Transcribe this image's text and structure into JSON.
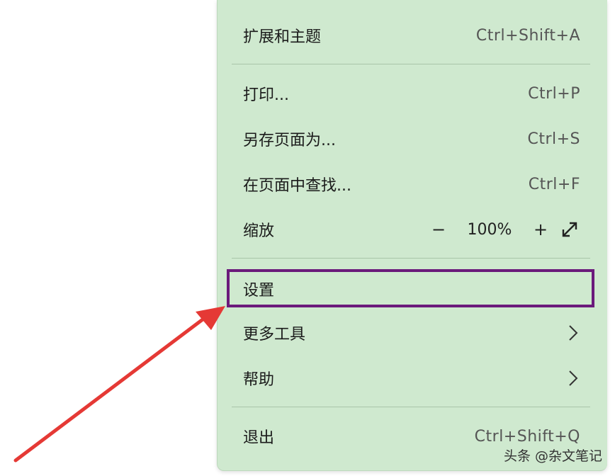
{
  "menu": {
    "extensions": {
      "label": "扩展和主题",
      "shortcut": "Ctrl+Shift+A"
    },
    "print": {
      "label": "打印...",
      "shortcut": "Ctrl+P"
    },
    "save_as": {
      "label": "另存页面为...",
      "shortcut": "Ctrl+S"
    },
    "find": {
      "label": "在页面中查找...",
      "shortcut": "Ctrl+F"
    },
    "zoom": {
      "label": "缩放",
      "minus": "−",
      "value": "100%",
      "plus": "+",
      "expand_icon": "fullscreen-expand-icon"
    },
    "settings": {
      "label": "设置"
    },
    "more_tools": {
      "label": "更多工具",
      "icon": "chevron-right-icon"
    },
    "help": {
      "label": "帮助",
      "icon": "chevron-right-icon"
    },
    "exit": {
      "label": "退出",
      "shortcut": "Ctrl+Shift+Q"
    }
  },
  "watermark": {
    "text": "头条 @杂文笔记"
  },
  "colors": {
    "menu_bg": "#cfe9cf",
    "highlight_border": "#6b1a7b",
    "arrow": "#e53935"
  }
}
